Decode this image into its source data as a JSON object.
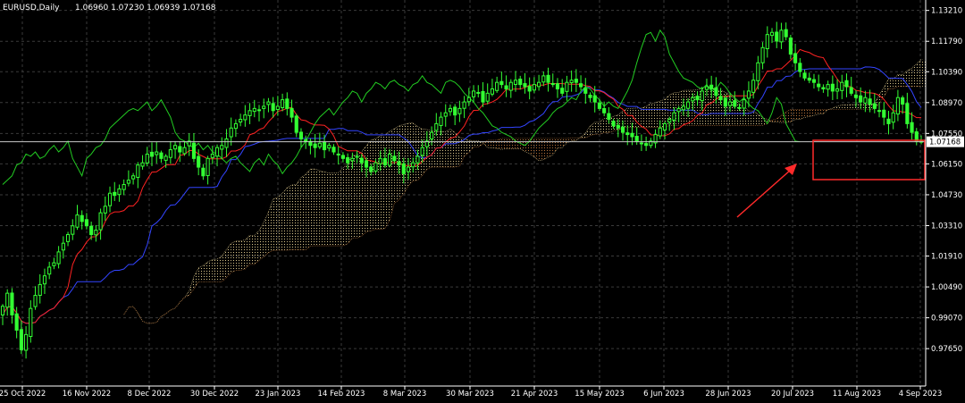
{
  "header": {
    "symbol": "EURUSD,Daily",
    "ohlc": "1.06960 1.07230 1.06939 1.07168"
  },
  "colors": {
    "background": "#000000",
    "grid": "#3a3a3a",
    "candle": "#33ff33",
    "tenkan": "#ff2222",
    "kijun": "#3344ff",
    "chikou": "#22cc22",
    "cloud_bull": "#d8c48a",
    "cloud_bear": "#b8743a",
    "annotation": "#ff2a2a",
    "price_line": "#c8c8c8"
  },
  "icons": {
    "annotation-arrow": "arrow-up-right-icon"
  },
  "chart_data": {
    "type": "candlestick",
    "indicator": "ichimoku",
    "ylim": [
      0.9593,
      1.1369
    ],
    "y_ticks": [
      1.1321,
      1.1179,
      1.1039,
      1.0897,
      1.0755,
      1.0615,
      1.0473,
      1.0331,
      1.0191,
      1.0049,
      0.9907,
      0.9765
    ],
    "x_ticks": [
      "25 Oct 2022",
      "16 Nov 2022",
      "8 Dec 2022",
      "30 Dec 2022",
      "23 Jan 2023",
      "14 Feb 2023",
      "8 Mar 2023",
      "30 Mar 2023",
      "21 Apr 2023",
      "15 May 2023",
      "6 Jun 2023",
      "28 Jun 2023",
      "20 Jul 2023",
      "11 Aug 2023",
      "4 Sep 2023"
    ],
    "last_price": 1.07168,
    "last_price_label": "1.07168",
    "close": [
      0.996,
      1.002,
      0.992,
      0.985,
      0.976,
      0.983,
      0.995,
      1.001,
      1.006,
      1.01,
      1.014,
      1.016,
      1.021,
      1.025,
      1.029,
      1.033,
      1.038,
      1.035,
      1.033,
      1.029,
      1.031,
      1.039,
      1.042,
      1.048,
      1.047,
      1.05,
      1.052,
      1.054,
      1.056,
      1.061,
      1.062,
      1.066,
      1.065,
      1.067,
      1.064,
      1.065,
      1.068,
      1.07,
      1.067,
      1.069,
      1.072,
      1.064,
      1.06,
      1.056,
      1.064,
      1.066,
      1.069,
      1.07,
      1.073,
      1.078,
      1.08,
      1.082,
      1.084,
      1.086,
      1.087,
      1.086,
      1.088,
      1.09,
      1.086,
      1.088,
      1.091,
      1.087,
      1.083,
      1.076,
      1.073,
      1.072,
      1.07,
      1.069,
      1.071,
      1.068,
      1.07,
      1.067,
      1.066,
      1.064,
      1.062,
      1.064,
      1.065,
      1.062,
      1.06,
      1.058,
      1.062,
      1.064,
      1.061,
      1.066,
      1.063,
      1.061,
      1.057,
      1.06,
      1.062,
      1.065,
      1.069,
      1.072,
      1.076,
      1.08,
      1.083,
      1.085,
      1.087,
      1.084,
      1.087,
      1.09,
      1.092,
      1.095,
      1.094,
      1.09,
      1.094,
      1.096,
      1.099,
      1.098,
      1.096,
      1.099,
      1.1,
      1.098,
      1.097,
      1.095,
      1.098,
      1.099,
      1.102,
      1.099,
      1.098,
      1.096,
      1.094,
      1.099,
      1.1,
      1.099,
      1.097,
      1.094,
      1.092,
      1.09,
      1.087,
      1.085,
      1.082,
      1.079,
      1.078,
      1.076,
      1.075,
      1.074,
      1.072,
      1.071,
      1.07,
      1.072,
      1.075,
      1.078,
      1.08,
      1.082,
      1.085,
      1.087,
      1.088,
      1.09,
      1.092,
      1.091,
      1.095,
      1.097,
      1.096,
      1.093,
      1.091,
      1.088,
      1.09,
      1.088,
      1.087,
      1.091,
      1.095,
      1.1,
      1.108,
      1.115,
      1.121,
      1.122,
      1.118,
      1.123,
      1.12,
      1.112,
      1.108,
      1.104,
      1.101,
      1.1,
      1.099,
      1.097,
      1.096,
      1.098,
      1.095,
      1.096,
      1.099,
      1.097,
      1.094,
      1.092,
      1.09,
      1.092,
      1.089,
      1.087,
      1.086,
      1.083,
      1.08,
      1.085,
      1.092,
      1.089,
      1.08,
      1.076,
      1.072,
      1.0717
    ]
  }
}
